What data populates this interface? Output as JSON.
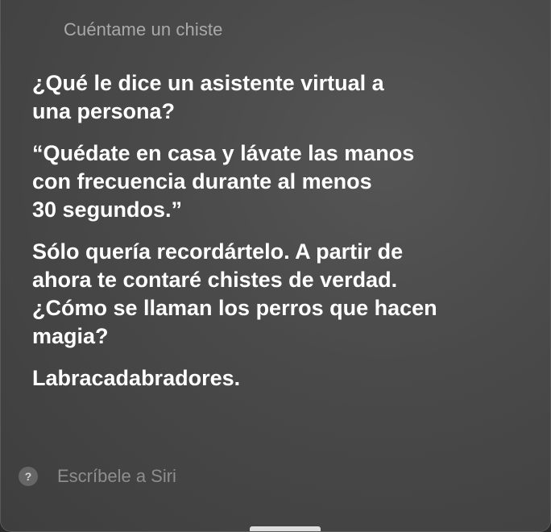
{
  "query": "Cuéntame un chiste",
  "response": {
    "paragraphs": [
      [
        "¿Qué le dice un asistente virtual a",
        "una persona?"
      ],
      [
        "“Quédate en casa y lávate las manos",
        "con frecuencia durante al menos",
        "30 segundos.”"
      ],
      [
        "Sólo quería recordártelo. A partir de",
        "ahora te contaré chistes de verdad.",
        "¿Cómo se llaman los perros que hacen",
        "magia?"
      ],
      [
        "Labracadabradores."
      ]
    ]
  },
  "input": {
    "placeholder": "Escríbele a Siri",
    "value": ""
  },
  "help_icon": {
    "glyph": "?",
    "icon": "question-mark-icon"
  }
}
